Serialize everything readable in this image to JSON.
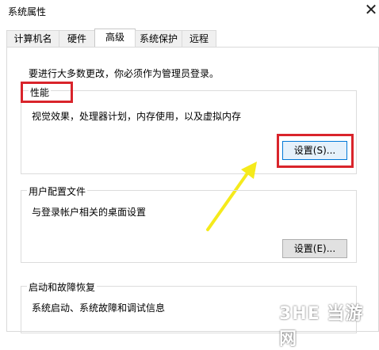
{
  "window": {
    "title": "系统属性",
    "close_glyph": "✕"
  },
  "tabs": [
    {
      "label": "计算机名"
    },
    {
      "label": "硬件"
    },
    {
      "label": "高级"
    },
    {
      "label": "系统保护"
    },
    {
      "label": "远程"
    }
  ],
  "active_tab": "高级",
  "note": "要进行大多数更改，你必须作为管理员登录。",
  "performance": {
    "title": "性能",
    "description": "视觉效果，处理器计划，内存使用，以及虚拟内存",
    "button": "设置(S)..."
  },
  "user_profiles": {
    "title": "用户配置文件",
    "description": "与登录帐户相关的桌面设置",
    "button": "设置(E)..."
  },
  "startup_recovery": {
    "title": "启动和故障恢复",
    "description": "系统启动、系统故障和调试信息"
  },
  "watermark": {
    "text": "3HE 当游网"
  },
  "annotations": {
    "highlight_color": "#d9242b",
    "arrow_color": "#f5ea1c"
  }
}
